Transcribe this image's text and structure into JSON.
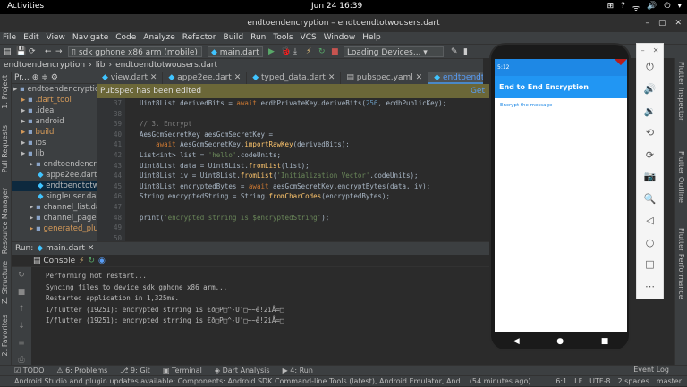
{
  "gnome": {
    "activities": "Activities",
    "clock": "Jun 24  16:39",
    "tray": [
      "⊞",
      "?",
      "ᯤ",
      "🔊",
      "⏻",
      "▾"
    ]
  },
  "window": {
    "title": "endtoendencryption – endtoendtotwousers.dart"
  },
  "menu": [
    "File",
    "Edit",
    "View",
    "Navigate",
    "Code",
    "Analyze",
    "Refactor",
    "Build",
    "Run",
    "Tools",
    "VCS",
    "Window",
    "Help"
  ],
  "toolbar": {
    "device": "sdk gphone x86 arm (mobile)",
    "run_config": "main.dart",
    "devices_combo": "Loading Devices..."
  },
  "breadcrumb": [
    "endtoendencryption",
    "lib",
    "endtoendtotwousers.dart"
  ],
  "project": {
    "header": "Pr...",
    "tree": [
      {
        "label": "endtoendencryption",
        "cls": "",
        "indent": 0
      },
      {
        "label": ".dart_tool",
        "cls": "orange",
        "indent": 1
      },
      {
        "label": ".idea",
        "cls": "",
        "indent": 1
      },
      {
        "label": "android",
        "cls": "",
        "indent": 1
      },
      {
        "label": "build",
        "cls": "orange",
        "indent": 1
      },
      {
        "label": "ios",
        "cls": "",
        "indent": 1
      },
      {
        "label": "lib",
        "cls": "",
        "indent": 1
      },
      {
        "label": "endtoendencryp",
        "cls": "",
        "indent": 2
      },
      {
        "label": "appe2ee.dart",
        "cls": "",
        "indent": 3
      },
      {
        "label": "endtoendtotw",
        "cls": "sel",
        "indent": 3
      },
      {
        "label": "singleuser.da",
        "cls": "",
        "indent": 3
      },
      {
        "label": "channel_list.dar",
        "cls": "",
        "indent": 2
      },
      {
        "label": "channel_page.d",
        "cls": "",
        "indent": 2
      },
      {
        "label": "generated_plug",
        "cls": "orange",
        "indent": 2
      }
    ]
  },
  "tabs": [
    {
      "label": "view.dart",
      "active": false
    },
    {
      "label": "appe2ee.dart",
      "active": false
    },
    {
      "label": "typed_data.dart",
      "active": false
    },
    {
      "label": "pubspec.yaml",
      "active": false
    },
    {
      "label": "endtoendtotwousers.dart",
      "active": true
    }
  ],
  "banner": {
    "text": "Pubspec has been edited",
    "action": "Get"
  },
  "editor": {
    "line_numbers": [
      "37",
      "38",
      "39",
      "40",
      "41",
      "42",
      "43",
      "44",
      "45",
      "46",
      "47",
      "48",
      "49",
      "50"
    ],
    "code": [
      "Uint8List derivedBits = await ecdhPrivateKey.deriveBits(256, ecdhPublicKey);",
      "",
      "// 3. Encrypt",
      "AesGcmSecretKey aesGcmSecretKey =",
      "    await AesGcmSecretKey.importRawKey(derivedBits);",
      "List<int> list = 'hello'.codeUnits;",
      "Uint8List data = Uint8List.fromList(list);",
      "Uint8List iv = Uint8List.fromList('Initialization Vector'.codeUnits);",
      "Uint8List encryptedBytes = await aesGcmSecretKey.encryptBytes(data, iv);",
      "String encryptedString = String.fromCharCodes(encryptedBytes);",
      "",
      "print('encrypted strring is $encryptedString');",
      "",
      ""
    ]
  },
  "run": {
    "label": "Run:",
    "config": "main.dart",
    "console_tab": "Console",
    "output": [
      "Performing hot restart...",
      "Syncing files to device sdk gphone x86 arm...",
      "Restarted application in 1,325ms.",
      "I/flutter (19251): encrypted strring is €ð□P□^-U'□~~ê!2iÅ=□",
      "I/flutter (19251): encrypted strring is €ð□P□^-U'□~~ê!2iÅ=□"
    ]
  },
  "bottom_tools": [
    "TODO",
    "6: Problems",
    "9: Git",
    "Terminal",
    "Dart Analysis",
    "4: Run"
  ],
  "event_log": "Event Log",
  "status": {
    "message": "Android Studio and plugin updates available: Components: Android SDK Command-line Tools (latest), Android Emulator, And... (54 minutes ago)",
    "right": [
      "6:1",
      "LF",
      "UTF-8",
      "2 spaces",
      "master"
    ]
  },
  "left_tool_tabs": [
    "1: Project",
    "Pull Requests",
    "Resource Manager",
    "Z: Structure",
    "2: Favorites"
  ],
  "right_tool_tabs": [
    "Flutter Inspector",
    "Flutter Outline",
    "Flutter Performance"
  ],
  "phone": {
    "time": "5:12",
    "app_title": "End to End Encryption",
    "encrypt_button": "Encrypt the message"
  },
  "emulator": {
    "buttons": [
      "power-icon",
      "volume-up-icon",
      "volume-down-icon",
      "rotate-left-icon",
      "rotate-right-icon",
      "camera-icon",
      "zoom-icon",
      "back-icon",
      "home-icon",
      "overview-icon",
      "more-icon"
    ]
  }
}
